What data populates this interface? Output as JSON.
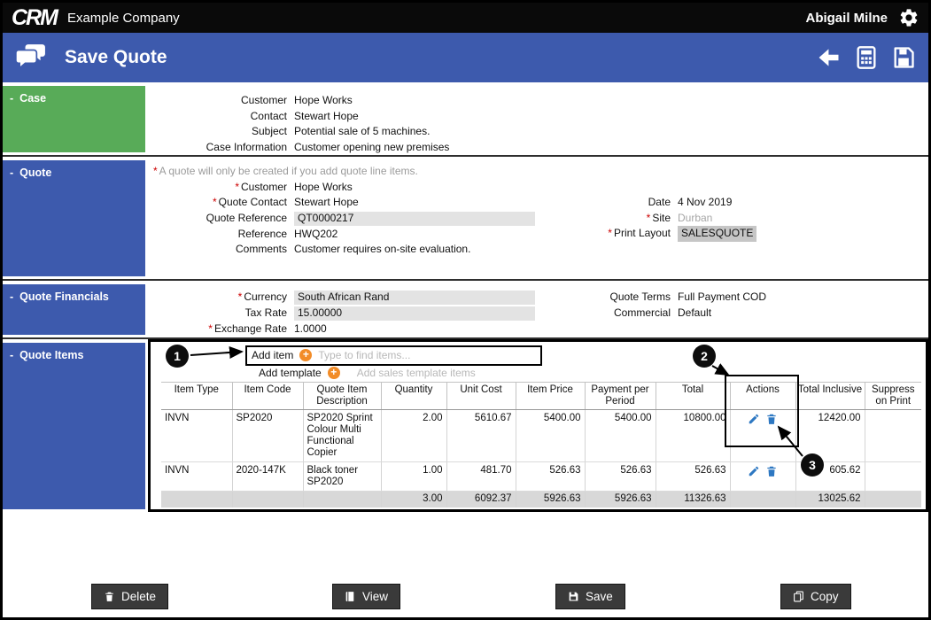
{
  "ui": {
    "required_marker": "*",
    "collapse_marker": "-"
  },
  "colors": {
    "header_blue": "#3d5aad",
    "case_green": "#58ab58",
    "accent_orange": "#f28c28",
    "action_icon_blue": "#2e78c2",
    "required_red": "#cc0000",
    "readonly_field_bg": "#e3e3e3",
    "totals_row_bg": "#d8d8d8"
  },
  "topbar": {
    "logo": "CRM",
    "company": "Example Company",
    "user": "Abigail Milne"
  },
  "header": {
    "title": "Save Quote"
  },
  "case": {
    "title": "Case",
    "fields": [
      {
        "label": "Customer",
        "value": "Hope Works"
      },
      {
        "label": "Contact",
        "value": "Stewart Hope"
      },
      {
        "label": "Subject",
        "value": "Potential sale of 5 machines."
      },
      {
        "label": "Case Information",
        "value": "Customer opening new premises"
      }
    ]
  },
  "quote": {
    "title": "Quote",
    "note": "A quote will only be created if you add quote line items.",
    "customer": {
      "label": "Customer",
      "value": "Hope Works"
    },
    "quote_contact": {
      "label": "Quote Contact",
      "value": "Stewart Hope"
    },
    "quote_reference": {
      "label": "Quote Reference",
      "value": "QT0000217"
    },
    "reference": {
      "label": "Reference",
      "value": "HWQ202"
    },
    "comments": {
      "label": "Comments",
      "value": "Customer requires on-site evaluation."
    },
    "date": {
      "label": "Date",
      "value": "4 Nov 2019"
    },
    "site": {
      "label": "Site",
      "value": "Durban"
    },
    "print_layout": {
      "label": "Print Layout",
      "value": "SALESQUOTE"
    }
  },
  "financials": {
    "title": "Quote Financials",
    "currency": {
      "label": "Currency",
      "value": "South African Rand"
    },
    "tax_rate": {
      "label": "Tax Rate",
      "value": "15.00000"
    },
    "exchange_rate": {
      "label": "Exchange Rate",
      "value": "1.0000"
    },
    "quote_terms": {
      "label": "Quote Terms",
      "value": "Full Payment COD"
    },
    "commercial": {
      "label": "Commercial",
      "value": "Default"
    }
  },
  "quote_items": {
    "title": "Quote Items",
    "add_item_label": "Add item",
    "add_item_placeholder": "Type to find items...",
    "add_template_label": "Add template",
    "add_template_placeholder": "Add sales template items",
    "table": {
      "headers": [
        "Item Type",
        "Item Code",
        "Quote Item Description",
        "Quantity",
        "Unit Cost",
        "Item Price",
        "Payment per Period",
        "Total",
        "Actions",
        "Total Inclusive",
        "Suppress on Print"
      ],
      "rows": [
        {
          "item_type": "INVN",
          "item_code": "SP2020",
          "description": "SP2020 Sprint Colour Multi Functional Copier",
          "quantity": "2.00",
          "unit_cost": "5610.67",
          "item_price": "5400.00",
          "payment_per_period": "5400.00",
          "total": "10800.00",
          "total_inclusive": "12420.00"
        },
        {
          "item_type": "INVN",
          "item_code": "2020-147K",
          "description": "Black toner SP2020",
          "quantity": "1.00",
          "unit_cost": "481.70",
          "item_price": "526.63",
          "payment_per_period": "526.63",
          "total": "526.63",
          "total_inclusive": "605.62"
        }
      ],
      "totals": {
        "quantity": "3.00",
        "unit_cost": "6092.37",
        "item_price": "5926.63",
        "payment_per_period": "5926.63",
        "total": "11326.63",
        "total_inclusive": "13025.62"
      }
    }
  },
  "annotations": {
    "step1": "1",
    "step2": "2",
    "step3": "3"
  },
  "footer": {
    "buttons": [
      {
        "label": "Delete"
      },
      {
        "label": "View"
      },
      {
        "label": "Save"
      },
      {
        "label": "Copy"
      }
    ]
  }
}
